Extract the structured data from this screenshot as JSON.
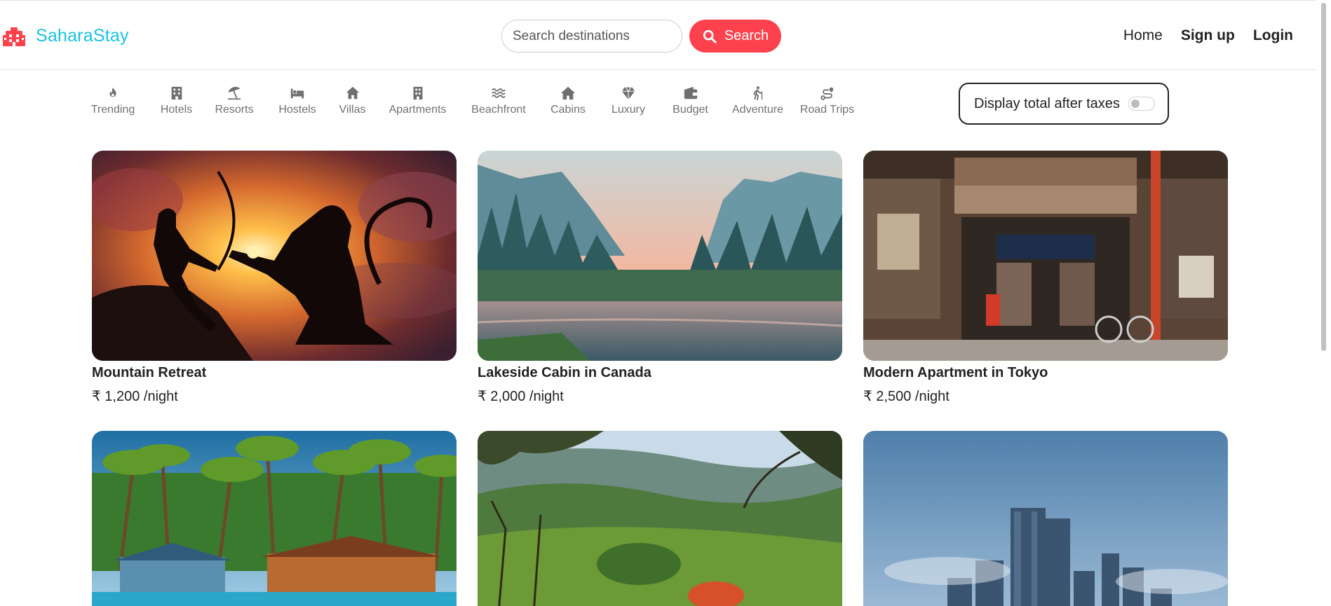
{
  "brand": {
    "name": "SaharaStay",
    "icon": "hotel-building-icon",
    "color": "#19c3e0"
  },
  "search": {
    "placeholder": "Search destinations",
    "value": "",
    "button_label": "Search",
    "button_color": "#fe424d"
  },
  "nav": {
    "home": "Home",
    "signup": "Sign up",
    "login": "Login"
  },
  "filters": [
    {
      "label": "Trending",
      "icon": "fire-icon"
    },
    {
      "label": "Hotels",
      "icon": "hotel-icon"
    },
    {
      "label": "Resorts",
      "icon": "umbrella-beach-icon"
    },
    {
      "label": "Hostels",
      "icon": "bed-icon"
    },
    {
      "label": "Villas",
      "icon": "house-icon"
    },
    {
      "label": "Apartments",
      "icon": "building-icon"
    },
    {
      "label": "Beachfront",
      "icon": "water-icon"
    },
    {
      "label": "Cabins",
      "icon": "cabin-icon"
    },
    {
      "label": "Luxury",
      "icon": "gem-icon"
    },
    {
      "label": "Budget",
      "icon": "wallet-icon"
    },
    {
      "label": "Adventure",
      "icon": "hiking-icon"
    },
    {
      "label": "Road Trips",
      "icon": "route-icon"
    }
  ],
  "tax_toggle": {
    "label": "Display total after taxes",
    "enabled": false
  },
  "listings": [
    {
      "title": "Mountain Retreat",
      "price": "₹ 1,200 /night"
    },
    {
      "title": "Lakeside Cabin in Canada",
      "price": "₹ 2,000 /night"
    },
    {
      "title": "Modern Apartment in Tokyo",
      "price": "₹ 2,500 /night"
    },
    {
      "title": "",
      "price": ""
    },
    {
      "title": "",
      "price": ""
    },
    {
      "title": "",
      "price": ""
    }
  ]
}
